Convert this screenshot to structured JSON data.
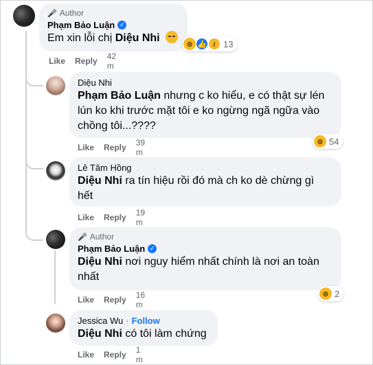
{
  "comments": [
    {
      "author_tag": "Author",
      "name": "Phạm Bảo Luận",
      "verified": true,
      "text": "Em xin lỗi chị",
      "mention": "Diệu Nhi",
      "reactions": [
        "haha",
        "like",
        "sad"
      ],
      "reaction_count": "13",
      "like": "Like",
      "reply": "Reply",
      "time": "42 m"
    },
    {
      "name": "Diệu Nhi",
      "mention": "Phạm Bảo Luận",
      "text_line1": "nhưng c ko hiểu, e có thật sự lén",
      "text_line2": "lún ko khi trước mặt tôi e ko ngừng ngã ngữa vào",
      "text_line3": "chồng tôi...????",
      "reactions": [
        "haha"
      ],
      "reaction_count": "54",
      "like": "Like",
      "reply": "Reply",
      "time": "39 m"
    },
    {
      "name": "Lê Tâm Hồng",
      "mention": "Diệu Nhi",
      "text_line1": "ra tín hiệu rồi đó mà ch ko dè chừng gì",
      "text_line2": "hết",
      "like": "Like",
      "reply": "Reply",
      "time": "19 m"
    },
    {
      "author_tag": "Author",
      "name": "Phạm Bảo Luận",
      "verified": true,
      "mention": "Diệu Nhi",
      "text_line1": "nơi nguy hiểm nhất chính là nơi an toàn",
      "text_line2": "nhất",
      "reactions": [
        "haha"
      ],
      "reaction_count": "2",
      "like": "Like",
      "reply": "Reply",
      "time": "16 m"
    },
    {
      "name": "Jessica Wu",
      "follow": "Follow",
      "separator": "·",
      "mention": "Diệu Nhi",
      "text": "có tôi làm chứng",
      "like": "Like",
      "reply": "Reply",
      "time": "1 m"
    }
  ],
  "icons": {
    "author_badge": "microphone-icon",
    "verified": "verified-badge-icon",
    "haha": "haha-reaction-icon",
    "like": "like-reaction-icon",
    "sad": "sad-reaction-icon",
    "inline_emoji": "disappointed-face-emoji"
  },
  "colors": {
    "bubble": "#f0f2f5",
    "link_blue": "#1877f2",
    "meta_gray": "#65676b",
    "thread_line": "#ced0d4"
  }
}
